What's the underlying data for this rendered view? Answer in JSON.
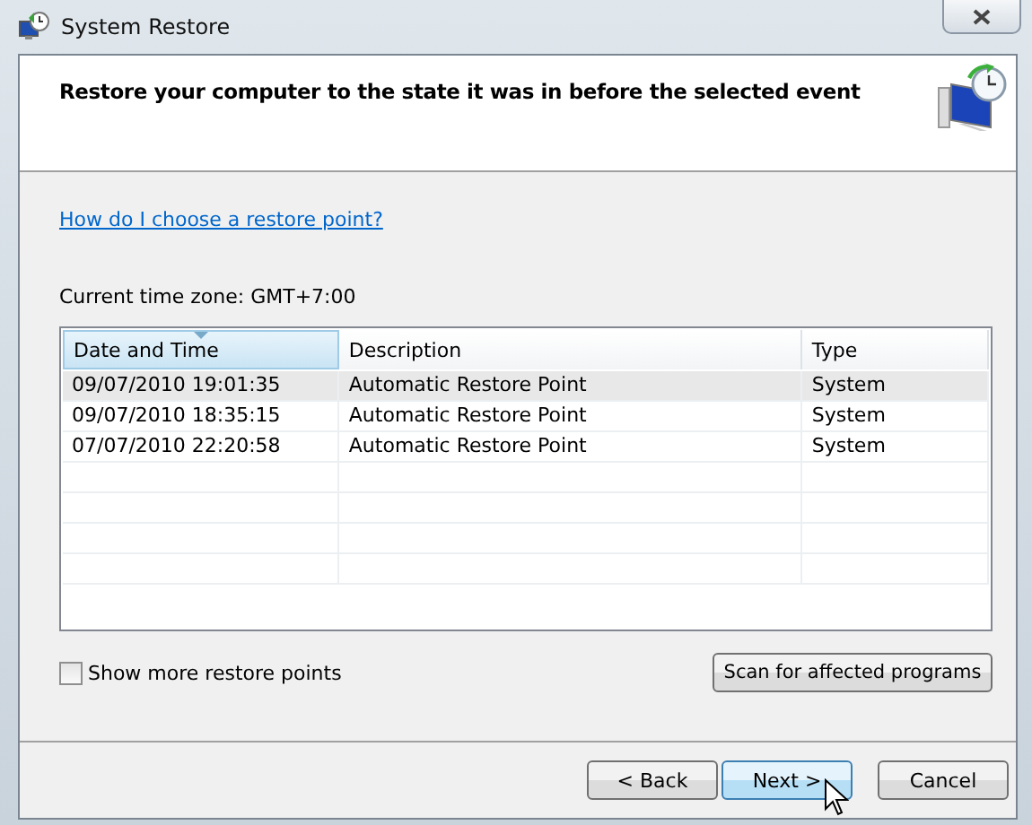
{
  "window": {
    "title": "System Restore"
  },
  "heading": "Restore your computer to the state it was in before the selected event",
  "help_link": "How do I choose a restore point?",
  "time_zone": "Current time zone: GMT+7:00",
  "table": {
    "columns": [
      {
        "label": "Date and Time",
        "sorted": true
      },
      {
        "label": "Description",
        "sorted": false
      },
      {
        "label": "Type",
        "sorted": false
      }
    ],
    "rows": [
      {
        "cells": [
          "09/07/2010 19:01:35",
          "Automatic Restore Point",
          "System"
        ],
        "selected": true
      },
      {
        "cells": [
          "09/07/2010 18:35:15",
          "Automatic Restore Point",
          "System"
        ],
        "selected": false
      },
      {
        "cells": [
          "07/07/2010 22:20:58",
          "Automatic Restore Point",
          "System"
        ],
        "selected": false
      }
    ]
  },
  "show_more": {
    "label": "Show more restore points",
    "checked": false
  },
  "scan_button": "Scan for affected programs",
  "buttons": [
    {
      "label": "< Back",
      "kind": "normal"
    },
    {
      "label": "Next >",
      "kind": "default"
    },
    {
      "label": "Cancel",
      "kind": "normal"
    }
  ]
}
